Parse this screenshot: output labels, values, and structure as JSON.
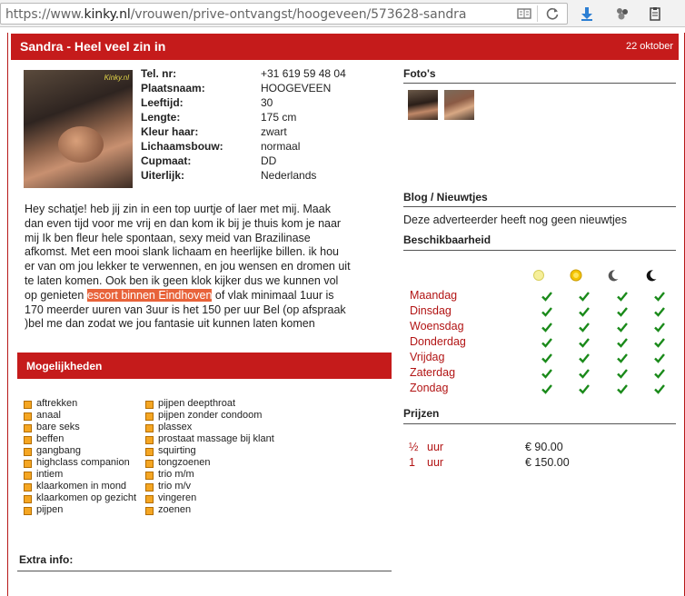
{
  "browser": {
    "url_prefix": "https://www.",
    "url_host": "kinky.nl",
    "url_path": "/vrouwen/prive-ontvangst/hoogeveen/573628-sandra"
  },
  "header": {
    "title": "Sandra - Heel veel zin in",
    "date": "22 oktober"
  },
  "photo": {
    "watermark": "Kinky.nl"
  },
  "details": [
    {
      "label": "Tel. nr:",
      "value": "+31 619 59 48 04"
    },
    {
      "label": "Plaatsnaam:",
      "value": "HOOGEVEEN"
    },
    {
      "label": "Leeftijd:",
      "value": "30"
    },
    {
      "label": "Lengte:",
      "value": "175 cm"
    },
    {
      "label": "Kleur haar:",
      "value": "zwart"
    },
    {
      "label": "Lichaamsbouw:",
      "value": "normaal"
    },
    {
      "label": "Cupmaat:",
      "value": "DD"
    },
    {
      "label": "Uiterlijk:",
      "value": "Nederlands"
    }
  ],
  "description": {
    "before": "Hey schatje! heb jij zin in een top uurtje of laer met mij. Maak dan even tijd voor me vrij en dan kom ik bij je thuis kom je naar mij Ik ben fleur hele spontaan, sexy meid van Brazilinase afkomst. Met een mooi slank lichaam en heerlijke billen. ik hou er van om jou lekker te verwennen, en jou wensen en dromen uit te laten komen. Ook ben ik geen klok kijker dus we kunnen vol op genieten ",
    "link": "escort binnen Eindhoven",
    "after": " of vlak minimaal 1uur is 170 meerder uuren van 3uur is het 150 per uur Bel (op afspraak )bel me dan zodat we jou fantasie uit kunnen laten komen"
  },
  "mogelijkheden": {
    "title": "Mogelijkheden",
    "col1": [
      "aftrekken",
      "anaal",
      "bare seks",
      "beffen",
      "gangbang",
      "highclass companion",
      "intiem",
      "klaarkomen in mond",
      "klaarkomen op gezicht",
      "pijpen"
    ],
    "col2": [
      "pijpen deepthroat",
      "pijpen zonder condoom",
      "plassex",
      "prostaat massage bij klant",
      "squirting",
      "tongzoenen",
      "trio m/m",
      "trio m/v",
      "vingeren",
      "zoenen"
    ]
  },
  "extra": {
    "title": "Extra info:"
  },
  "fotos": {
    "title": "Foto's"
  },
  "blog": {
    "title": "Blog / Nieuwtjes",
    "text": "Deze adverteerder heeft nog geen nieuwtjes"
  },
  "beschikbaarheid": {
    "title": "Beschikbaarheid",
    "periods": [
      "morning-sun-icon",
      "afternoon-sun-icon",
      "evening-moon-icon",
      "night-moon-icon"
    ],
    "days": [
      "Maandag",
      "Dinsdag",
      "Woensdag",
      "Donderdag",
      "Vrijdag",
      "Zaterdag",
      "Zondag"
    ],
    "available": [
      [
        true,
        true,
        true,
        true
      ],
      [
        true,
        true,
        true,
        true
      ],
      [
        true,
        true,
        true,
        true
      ],
      [
        true,
        true,
        true,
        true
      ],
      [
        true,
        true,
        true,
        true
      ],
      [
        true,
        true,
        true,
        true
      ],
      [
        true,
        true,
        true,
        true
      ]
    ],
    "check_color": "#1a8a1a"
  },
  "prijzen": {
    "title": "Prijzen",
    "rows": [
      {
        "qty": "½",
        "unit": "uur",
        "price": "€ 90.00"
      },
      {
        "qty": "1",
        "unit": "uur",
        "price": "€ 150.00"
      }
    ]
  },
  "colors": {
    "brand_red": "#c51b1b",
    "text_red": "#b21414",
    "bullet": "#f5a623"
  }
}
